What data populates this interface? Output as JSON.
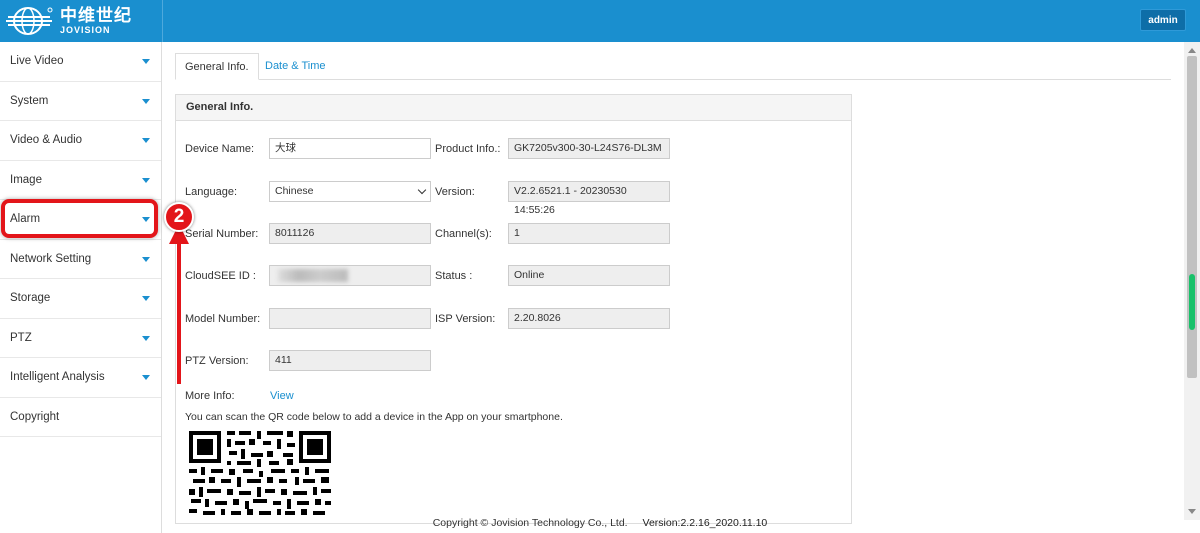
{
  "header": {
    "logo_cn": "中维世纪",
    "logo_en": "JOVISION",
    "user": "admin",
    "color": "#1a8fcf"
  },
  "sidebar": {
    "items": [
      {
        "label": "Live Video",
        "has_caret": true
      },
      {
        "label": "System",
        "has_caret": true
      },
      {
        "label": "Video & Audio",
        "has_caret": true
      },
      {
        "label": "Image",
        "has_caret": true
      },
      {
        "label": "Alarm",
        "has_caret": true,
        "highlighted": true
      },
      {
        "label": "Network Setting",
        "has_caret": true
      },
      {
        "label": "Storage",
        "has_caret": true
      },
      {
        "label": "PTZ",
        "has_caret": true
      },
      {
        "label": "Intelligent Analysis",
        "has_caret": true
      },
      {
        "label": "Copyright",
        "has_caret": false
      }
    ]
  },
  "annotation": {
    "step_number": "2",
    "color": "#e3151a"
  },
  "tabs": [
    {
      "label": "General Info.",
      "active": true
    },
    {
      "label": "Date & Time",
      "active": false
    }
  ],
  "panel": {
    "title": "General Info.",
    "device_name_label": "Device Name:",
    "device_name_value": "大球",
    "product_info_label": "Product Info.:",
    "product_info_value": "GK7205v300-30-L24S76-DL3M",
    "language_label": "Language:",
    "language_value": "Chinese",
    "version_label": "Version:",
    "version_value": "V2.2.6521.1 - 20230530 14:55:26",
    "serial_label": "Serial Number:",
    "serial_value": "8011126",
    "channels_label": "Channel(s):",
    "channels_value": "1",
    "cloudsee_label": "CloudSEE ID :",
    "status_label": "Status :",
    "status_value": "Online",
    "model_label": "Model Number:",
    "model_value": "",
    "isp_label": "ISP Version:",
    "isp_value": "2.20.8026",
    "ptz_label": "PTZ Version:",
    "ptz_value": "411",
    "more_info_label": "More Info:",
    "more_info_link": "View",
    "qr_text": "You can scan the QR code below to add a device in the App on your smartphone."
  },
  "footer": {
    "copyright": "Copyright © Jovision Technology Co., Ltd.",
    "version": "Version:2.2.16_2020.11.10"
  }
}
